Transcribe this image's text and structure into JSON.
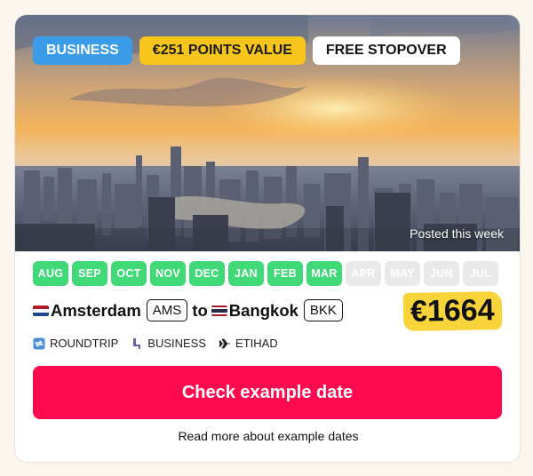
{
  "badges": {
    "cabin": "BUSINESS",
    "points": "€251 POINTS VALUE",
    "stopover": "FREE STOPOVER"
  },
  "hero": {
    "posted": "Posted this week"
  },
  "months": [
    {
      "label": "AUG",
      "available": true
    },
    {
      "label": "SEP",
      "available": true
    },
    {
      "label": "OCT",
      "available": true
    },
    {
      "label": "NOV",
      "available": true
    },
    {
      "label": "DEC",
      "available": true
    },
    {
      "label": "JAN",
      "available": true
    },
    {
      "label": "FEB",
      "available": true
    },
    {
      "label": "MAR",
      "available": true
    },
    {
      "label": "APR",
      "available": false
    },
    {
      "label": "MAY",
      "available": false
    },
    {
      "label": "JUN",
      "available": false
    },
    {
      "label": "JUL",
      "available": false
    }
  ],
  "route": {
    "origin": "Amsterdam",
    "origin_code": "AMS",
    "connector": "to",
    "destination": "Bangkok",
    "destination_code": "BKK"
  },
  "price": "€1664",
  "meta": {
    "trip_type": "ROUNDTRIP",
    "cabin": "BUSINESS",
    "airline": "ETIHAD"
  },
  "cta": {
    "label": "Check example date"
  },
  "more_link": "Read more about example dates",
  "colors": {
    "cabin_badge": "#3a9be8",
    "points_badge": "#f7c51b",
    "month_available": "#3fd977",
    "month_unavailable": "#e9e9e9",
    "cta": "#ff0a4f",
    "price_highlight": "#f8d33a"
  },
  "icons": {
    "trip_type": "roundtrip-icon",
    "cabin": "seat-icon",
    "airline": "plane-icon"
  }
}
